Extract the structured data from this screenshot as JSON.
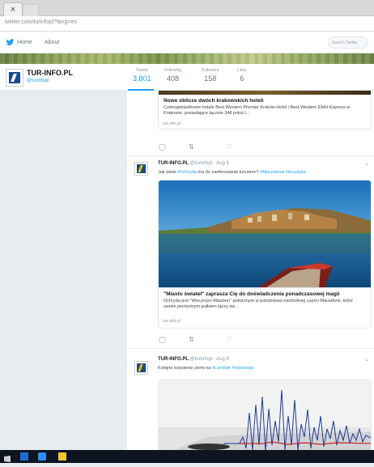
{
  "browser": {
    "tab_close": "×",
    "url": "twitter.com/turinfopl?lang=en"
  },
  "nav": {
    "home": "Home",
    "about": "About",
    "search_placeholder": "Search Twitter"
  },
  "profile": {
    "name": "TUR-INFO.PL",
    "handle": "@turinfopl",
    "stats": [
      {
        "label": "Tweets",
        "value": "3,801"
      },
      {
        "label": "Following",
        "value": "408"
      },
      {
        "label": "Followers",
        "value": "158"
      },
      {
        "label": "Likes",
        "value": "6"
      }
    ]
  },
  "card0": {
    "title": "Nowe oblicze dwóch krakowskich hoteli",
    "desc": "Czterogwiazdkowe hotele Best Western Premier Kraków Hotel i Best Western Efekt Express w Krakowie, posiadające łącznie 348 pokoi i…",
    "url": "tur-info.pl"
  },
  "tweet1": {
    "name": "TUR-INFO.PL",
    "meta": "@turinfopl · Aug 9",
    "text_pre": "Jak wiele ",
    "hash1": "#Ochryda",
    "text_mid": " ma do zaoferowania turystom? ",
    "hash2": "#Macedonia #turystyka",
    "card_title": "\"Miasto świateł\" zaprasza Cię do doświadczenia ponadczasowej magii",
    "card_desc": "Ochryda jest \"Wiecznym Miastem\" położonym w południowo-zachodniej części Macedonii, które swoim pierwotnym pułkiem łączy się…",
    "card_url": "tur-info.pl"
  },
  "tweet2": {
    "name": "TUR-INFO.PL",
    "meta": "@turinfopl · Aug 9",
    "text_pre": "Kolejne trzęsienie ziemi na ",
    "hash1": "#Lombok",
    "hash2": "#Indonezja"
  },
  "icons": {
    "reply": "♡",
    "retweet": "⇅",
    "like": "♡",
    "chevron": "⌄"
  }
}
